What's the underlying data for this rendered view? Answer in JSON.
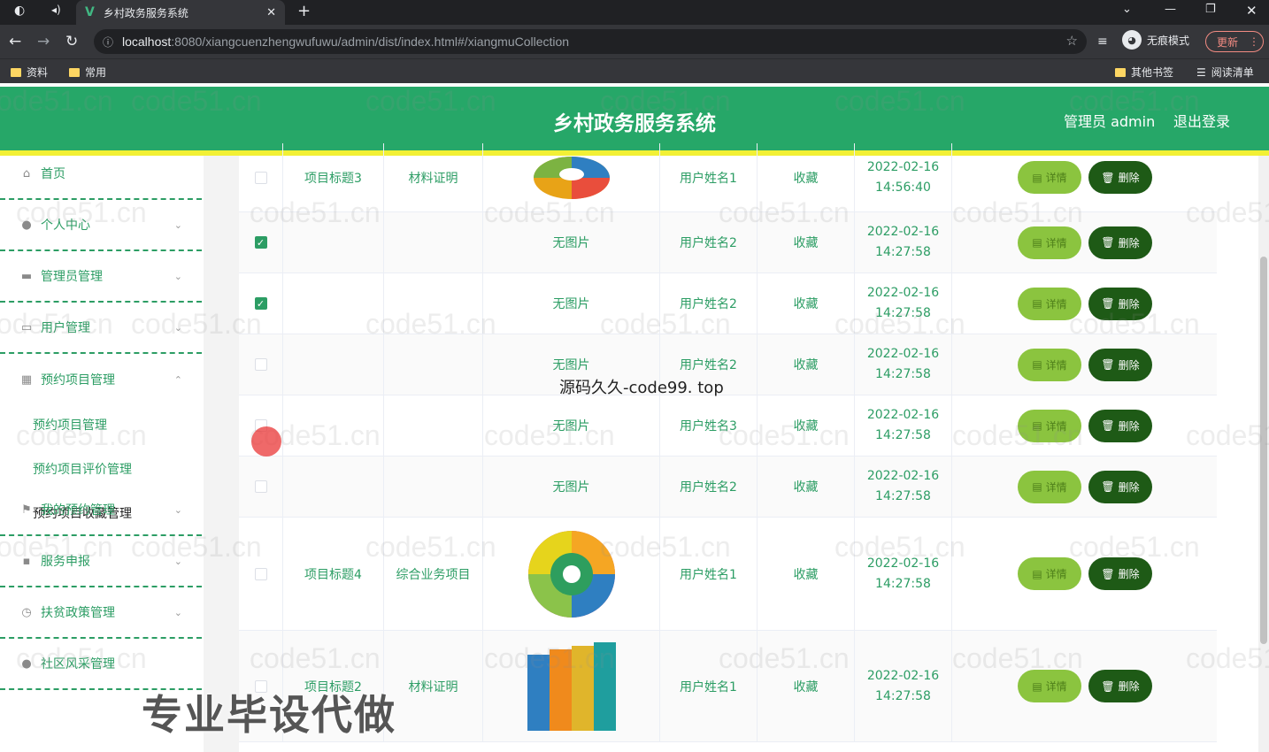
{
  "browser": {
    "tab_title": "乡村政务服务系统",
    "url_host": "localhost",
    "url_path": ":8080/xiangcuenzhengwufuwu/admin/dist/index.html#/xiangmuCollection",
    "incognito_label": "无痕模式",
    "update_label": "更新",
    "bookmarks": [
      "资料",
      "常用"
    ],
    "bookmarks_right": [
      "其他书签",
      "阅读清单"
    ]
  },
  "header": {
    "title": "乡村政务服务系统",
    "admin_label": "管理员 admin",
    "logout_label": "退出登录"
  },
  "sidebar": {
    "items": [
      {
        "label": "首页",
        "icon": "home-icon"
      },
      {
        "label": "个人中心",
        "icon": "user-icon"
      },
      {
        "label": "管理员管理",
        "icon": "briefcase-icon"
      },
      {
        "label": "用户管理",
        "icon": "chat-icon"
      },
      {
        "label": "预约项目管理",
        "icon": "grid-icon"
      },
      {
        "label": "我的预约管理",
        "icon": "flag-icon"
      },
      {
        "label": "服务申报",
        "icon": "message-icon"
      },
      {
        "label": "扶贫政策管理",
        "icon": "clock-icon"
      },
      {
        "label": "社区风采管理",
        "icon": "user-icon"
      }
    ],
    "subitems": [
      "预约项目管理",
      "预约项目评价管理",
      "预约项目收藏管理"
    ]
  },
  "table": {
    "rows": [
      {
        "checked": false,
        "title": "项目标题3",
        "type": "材料证明",
        "image": "pie-chart",
        "user": "用户姓名1",
        "kind": "收藏",
        "datetime": "2022-02-16\n14:56:40"
      },
      {
        "checked": true,
        "title": "",
        "type": "",
        "image": "无图片",
        "user": "用户姓名2",
        "kind": "收藏",
        "datetime": "2022-02-16\n14:27:58"
      },
      {
        "checked": true,
        "title": "",
        "type": "",
        "image": "无图片",
        "user": "用户姓名2",
        "kind": "收藏",
        "datetime": "2022-02-16\n14:27:58"
      },
      {
        "checked": false,
        "title": "",
        "type": "",
        "image": "无图片",
        "user": "用户姓名2",
        "kind": "收藏",
        "datetime": "2022-02-16\n14:27:58"
      },
      {
        "checked": false,
        "title": "",
        "type": "",
        "image": "无图片",
        "user": "用户姓名3",
        "kind": "收藏",
        "datetime": "2022-02-16\n14:27:58"
      },
      {
        "checked": false,
        "title": "",
        "type": "",
        "image": "无图片",
        "user": "用户姓名2",
        "kind": "收藏",
        "datetime": "2022-02-16\n14:27:58"
      },
      {
        "checked": false,
        "title": "项目标题4",
        "type": "综合业务项目",
        "image": "wheel-chart",
        "user": "用户姓名1",
        "kind": "收藏",
        "datetime": "2022-02-16\n14:27:58"
      },
      {
        "checked": false,
        "title": "项目标题2",
        "type": "材料证明",
        "image": "bar-chart",
        "user": "用户姓名1",
        "kind": "收藏",
        "datetime": "2022-02-16\n14:27:58"
      }
    ],
    "detail_label": "详情",
    "delete_label": "删除"
  },
  "overlays": {
    "watermark": "code51.cn",
    "site_text": "源码久久-code99. top",
    "promo_text": "专业毕设代做"
  },
  "colors": {
    "primary": "#26a768",
    "accent": "#f2f035",
    "detail_btn": "#8bc43f",
    "delete_btn": "#1e5a16"
  }
}
